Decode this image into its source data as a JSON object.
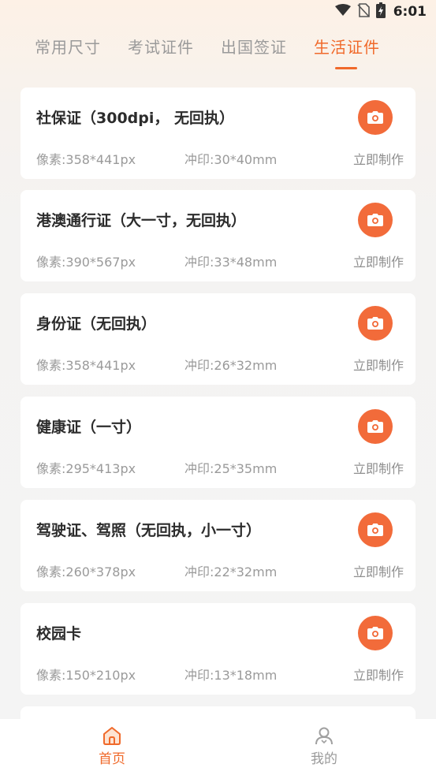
{
  "status_bar": {
    "time": "6:01",
    "icons": [
      "wifi-icon",
      "no-sim-icon",
      "battery-icon"
    ]
  },
  "tabs": [
    {
      "label": "常用尺寸",
      "active": false
    },
    {
      "label": "考试证件",
      "active": false
    },
    {
      "label": "出国签证",
      "active": false
    },
    {
      "label": "生活证件",
      "active": true
    }
  ],
  "cards": [
    {
      "title": "社保证（300dpi， 无回执）",
      "pixel": "像素:358*441px",
      "print": "冲印:30*40mm",
      "action": "立即制作",
      "icon": "camera-icon"
    },
    {
      "title": "港澳通行证（大一寸，无回执）",
      "pixel": "像素:390*567px",
      "print": "冲印:33*48mm",
      "action": "立即制作",
      "icon": "camera-icon"
    },
    {
      "title": "身份证（无回执）",
      "pixel": "像素:358*441px",
      "print": "冲印:26*32mm",
      "action": "立即制作",
      "icon": "camera-icon"
    },
    {
      "title": "健康证（一寸）",
      "pixel": "像素:295*413px",
      "print": "冲印:25*35mm",
      "action": "立即制作",
      "icon": "camera-icon"
    },
    {
      "title": "驾驶证、驾照（无回执，小一寸）",
      "pixel": "像素:260*378px",
      "print": "冲印:22*32mm",
      "action": "立即制作",
      "icon": "camera-icon"
    },
    {
      "title": "校园卡",
      "pixel": "像素:150*210px",
      "print": "冲印:13*18mm",
      "action": "立即制作",
      "icon": "camera-icon"
    }
  ],
  "bottom_nav": [
    {
      "label": "首页",
      "icon": "home-icon",
      "active": true
    },
    {
      "label": "我的",
      "icon": "user-icon",
      "active": false
    }
  ],
  "colors": {
    "accent": "#f0692a",
    "camera_button": "#f26b3a",
    "inactive_text": "#9a9a9a"
  }
}
